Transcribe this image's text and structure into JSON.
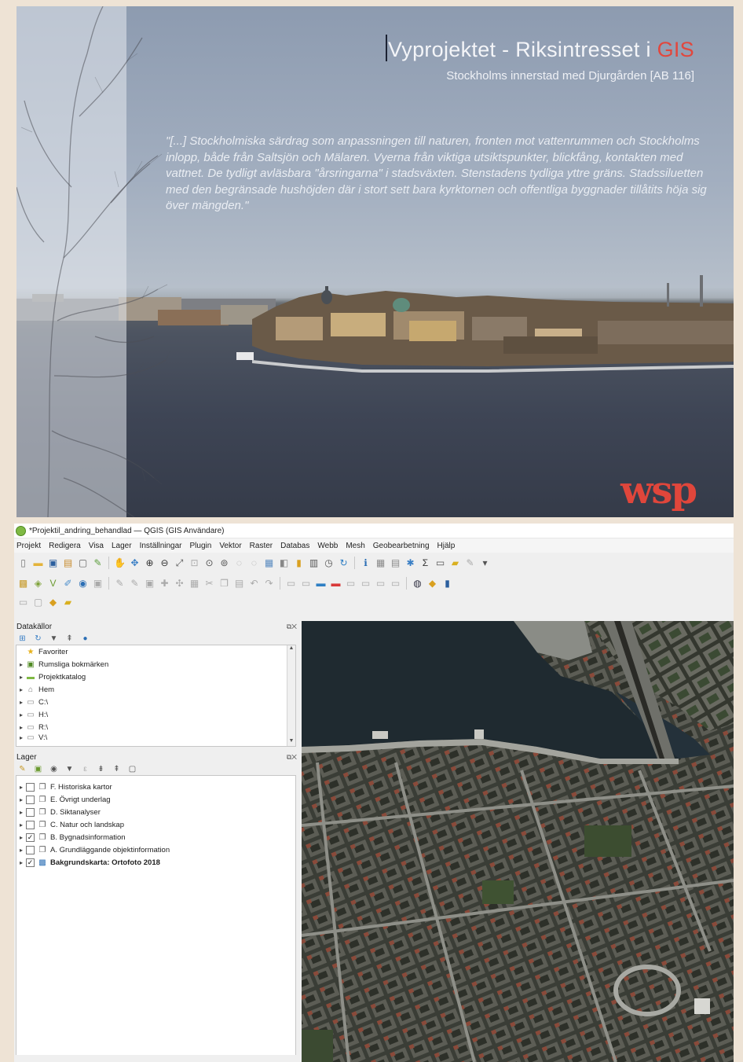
{
  "poster": {
    "title_main": "Vyprojektet - Riksintresset i ",
    "title_accent": "GIS",
    "subtitle": "Stockholms innerstad med Djurgården [AB 116]",
    "quote": "\"[...] Stockholmiska särdrag som anpassningen till naturen, fronten mot vattenrummen och Stockholms inlopp, både från Saltsjön och Mälaren. Vyerna från viktiga utsiktspunkter, blickfång, kontakten med vattnet. De tydligt avläsbara \"årsringarna\" i stadsväxten. Stenstadens tydliga yttre gräns. Stadssiluetten med den begränsade hushöjden där i stort sett bara kyrktornen och offentliga byggnader tillåtits höja sig över mängden.\"",
    "logo": "wsp",
    "colors": {
      "accent": "#e2473d",
      "water": "#3e4555",
      "sky": "#a3afc0"
    }
  },
  "qgis": {
    "window_title": "*Projektil_andring_behandlad — QGIS (GIS Användare)",
    "menu": [
      "Projekt",
      "Redigera",
      "Visa",
      "Lager",
      "Inställningar",
      "Plugin",
      "Vektor",
      "Raster",
      "Databas",
      "Webb",
      "Mesh",
      "Geobearbetning",
      "Hjälp"
    ],
    "browser_panel": {
      "title": "Datakällor",
      "items": [
        {
          "label": "Favoriter",
          "icon": "star-icon"
        },
        {
          "label": "Rumsliga bokmärken",
          "icon": "bookmark-icon"
        },
        {
          "label": "Projektkatalog",
          "icon": "folder-icon"
        },
        {
          "label": "Hem",
          "icon": "home-folder-icon"
        },
        {
          "label": "C:\\",
          "icon": "drive-icon"
        },
        {
          "label": "H:\\",
          "icon": "drive-icon"
        },
        {
          "label": "R:\\",
          "icon": "drive-icon"
        },
        {
          "label": "V:\\",
          "icon": "drive-icon"
        }
      ]
    },
    "layers_panel": {
      "title": "Lager",
      "items": [
        {
          "label": "F. Historiska kartor",
          "checked": false,
          "bold": false,
          "icon": "layer-group-icon"
        },
        {
          "label": "E. Övrigt underlag",
          "checked": false,
          "bold": false,
          "icon": "layer-group-icon"
        },
        {
          "label": "D. Siktanalyser",
          "checked": false,
          "bold": false,
          "icon": "layer-group-icon"
        },
        {
          "label": "C. Natur och landskap",
          "checked": false,
          "bold": false,
          "icon": "layer-group-icon"
        },
        {
          "label": "B. Bygnadsinformation",
          "checked": true,
          "bold": false,
          "icon": "layer-group-icon"
        },
        {
          "label": "A. Grundläggande objektinformation",
          "checked": false,
          "bold": false,
          "icon": "layer-group-icon"
        },
        {
          "label": "Bakgrundskarta: Ortofoto 2018",
          "checked": true,
          "bold": true,
          "icon": "raster-layer-icon"
        }
      ]
    }
  }
}
